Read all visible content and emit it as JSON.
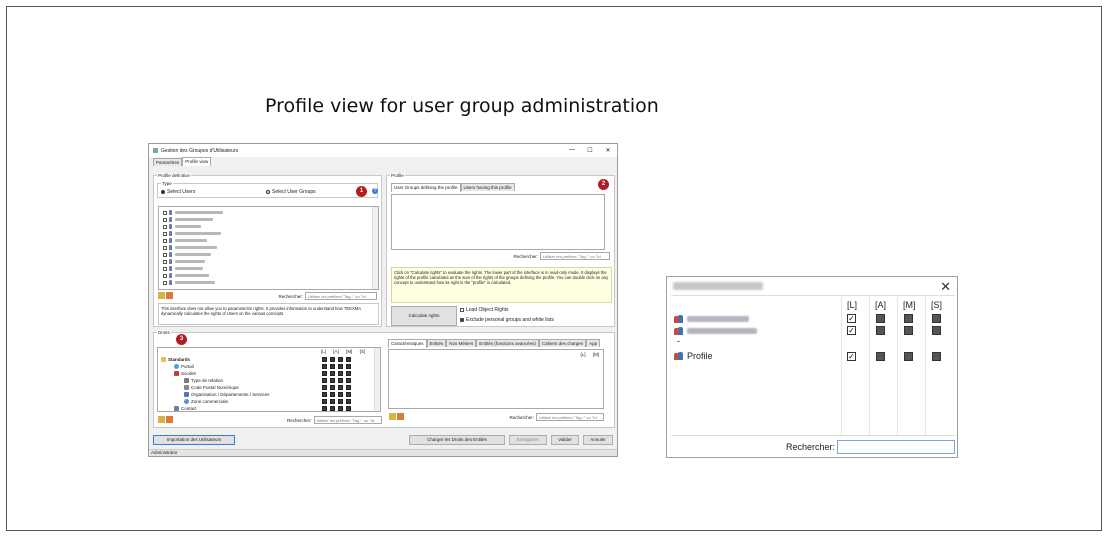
{
  "slide": {
    "title": "Profile view for user group administration"
  },
  "window": {
    "title": "Gestion des Groupes d'Utilisateurs",
    "controls": {
      "minimize": "—",
      "maximize": "☐",
      "close": "✕"
    },
    "tabs": [
      "Paramètres",
      "Profile view"
    ],
    "profile_definition": {
      "legend": "Profile definition",
      "type_legend": "Type",
      "radio_users": "Select Users",
      "radio_groups": "Select User Groups",
      "badge": "1",
      "search_label": "Rechercher:",
      "search_placeholder": "Utiliser les préfixes \"Tag :\" ou \"Id",
      "info": "This interface does not allow you to parameterize rights. It provides information to understand how TEEXMA dynamically calculates the rights of Users on the various concepts."
    },
    "profile": {
      "legend": "Profile",
      "badge": "2",
      "tabs": [
        "User Groups defining the profile",
        "Users having this profile"
      ],
      "search_label": "Rechercher:",
      "search_placeholder": "Utiliser les préfixes \"Tag :\" ou \"Id",
      "info": "Click on \"Calculate rights\" to evaluate the rights. The lower part of the interface is in read-only mode. It displays the rights of the profile calculated as the sum of the rights of the groups defining the profile. You can double click on any concept to understand how its right in the \"profile\" is calculated.",
      "calc_button": "Calculate rights",
      "load_object": "Load Object Rights",
      "exclude": "Exclude personal groups and white lists"
    },
    "rights": {
      "legend": "Droits",
      "badge": "3",
      "columns": [
        "[L]",
        "[A]",
        "[M]",
        "[S]"
      ],
      "tree": [
        "Standards",
        "Portail",
        "Société",
        "Type de relation",
        "Code Postal Numérique",
        "Organisation / Départements / Services",
        "Zone commerciale",
        "Contact"
      ],
      "search_label": "Rechercher:",
      "search_placeholder": "Utiliser les préfixes \"Tag :\" ou \"Id",
      "tabs": [
        "Caractéristiques",
        "Entités",
        "Nos Métiers",
        "Entités (fonctions avancées)",
        "Cahiers des charges",
        "App"
      ],
      "right_columns": [
        "[L]",
        "[M]"
      ]
    },
    "footer": {
      "import_button": "Importation des Utilisateurs",
      "load_button": "Charger les Droits des Entités",
      "save_button": "Enregistrer",
      "validate_button": "Valider",
      "cancel_button": "Annuler",
      "status": "Administrator"
    }
  },
  "dialog": {
    "close": "✕",
    "columns": [
      "[L]",
      "[A]",
      "[M]",
      "[S]"
    ],
    "profile_label": "Profile",
    "dash": "-",
    "search_label": "Rechercher:"
  }
}
